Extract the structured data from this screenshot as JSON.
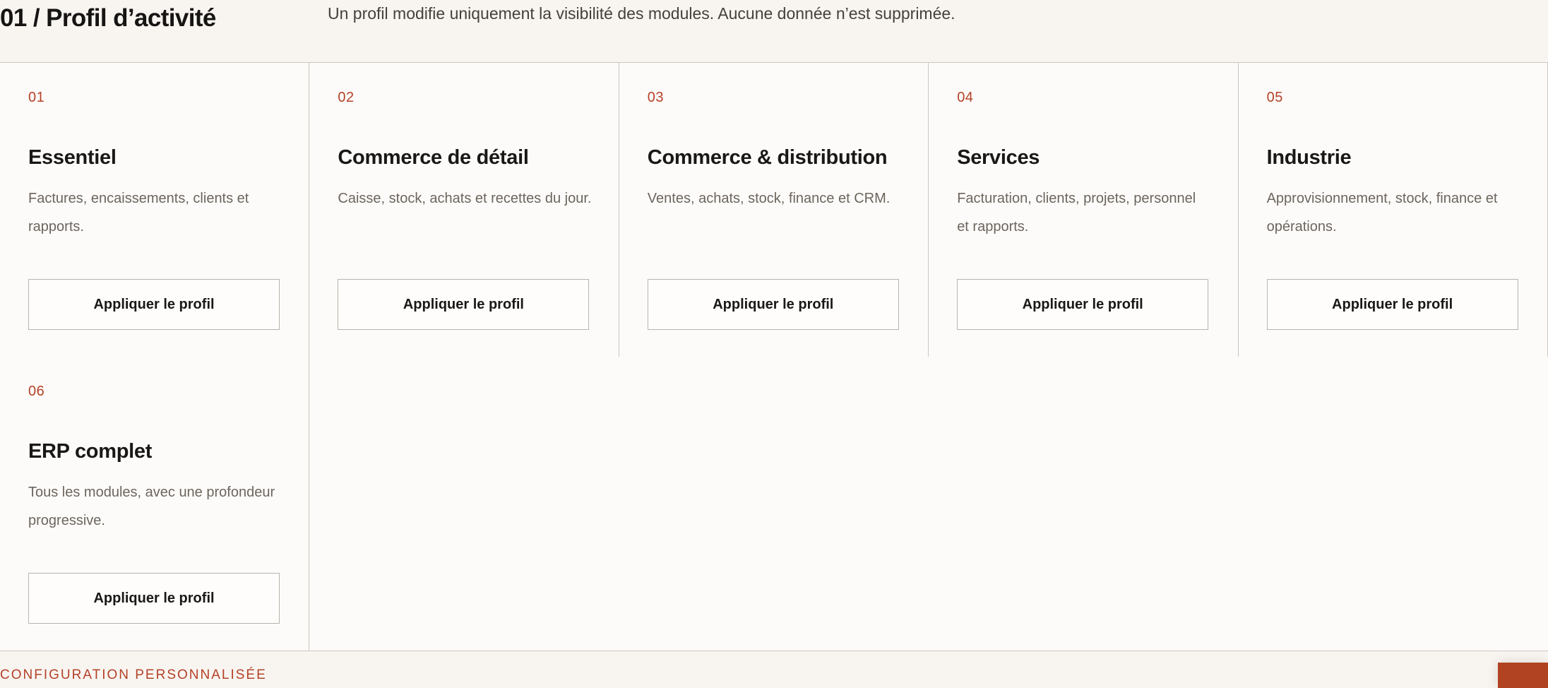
{
  "header": {
    "title": "01 / Profil d’activité",
    "description": "Un profil modifie uniquement la visibilité des modules. Aucune donnée n’est supprimée."
  },
  "profiles": [
    {
      "number": "01",
      "name": "Essentiel",
      "description": "Factures, encaissements, clients et rapports.",
      "button_label": "Appliquer le profil"
    },
    {
      "number": "02",
      "name": "Commerce de détail",
      "description": "Caisse, stock, achats et recettes du jour.",
      "button_label": "Appliquer le profil"
    },
    {
      "number": "03",
      "name": "Commerce & distribution",
      "description": "Ventes, achats, stock, finance et CRM.",
      "button_label": "Appliquer le profil"
    },
    {
      "number": "04",
      "name": "Services",
      "description": "Facturation, clients, projets, personnel et rapports.",
      "button_label": "Appliquer le profil"
    },
    {
      "number": "05",
      "name": "Industrie",
      "description": "Approvisionnement, stock, finance et opérations.",
      "button_label": "Appliquer le profil"
    },
    {
      "number": "06",
      "name": "ERP complet",
      "description": "Tous les modules, avec une profondeur progressive.",
      "button_label": "Appliquer le profil"
    }
  ],
  "footer": {
    "label": "CONFIGURATION PERSONNALISÉE"
  },
  "colors": {
    "accent": "#b44127",
    "background": "#f8f5f1",
    "card_background": "#fdfbf9",
    "border": "#cbc6c0"
  }
}
